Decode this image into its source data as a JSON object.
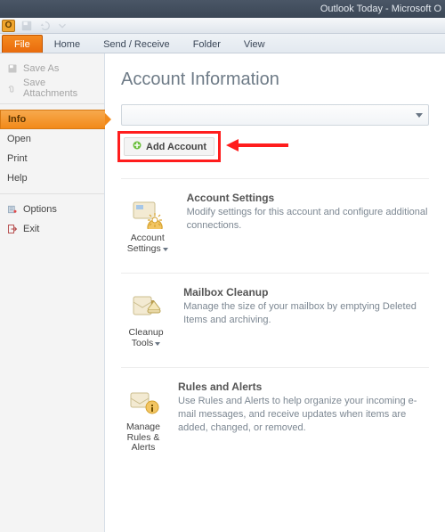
{
  "titlebar": {
    "text": "Outlook Today - Microsoft O"
  },
  "iconbar": {
    "app_glyph": "O"
  },
  "ribbon": {
    "tabs": [
      {
        "label": "File",
        "active": true
      },
      {
        "label": "Home"
      },
      {
        "label": "Send / Receive"
      },
      {
        "label": "Folder"
      },
      {
        "label": "View"
      }
    ]
  },
  "sidebar": {
    "save_as": "Save As",
    "save_attachments": "Save Attachments",
    "info": "Info",
    "open": "Open",
    "print": "Print",
    "help": "Help",
    "options": "Options",
    "exit": "Exit"
  },
  "main": {
    "title": "Account Information",
    "add_account": "Add Account",
    "sections": [
      {
        "btn_label": "Account Settings",
        "heading": "Account Settings",
        "desc": "Modify settings for this account and configure additional connections."
      },
      {
        "btn_label": "Cleanup Tools",
        "heading": "Mailbox Cleanup",
        "desc": "Manage the size of your mailbox by emptying Deleted Items and archiving."
      },
      {
        "btn_label": "Manage Rules & Alerts",
        "heading": "Rules and Alerts",
        "desc": "Use Rules and Alerts to help organize your incoming e-mail messages, and receive updates when items are added, changed, or removed."
      }
    ]
  }
}
